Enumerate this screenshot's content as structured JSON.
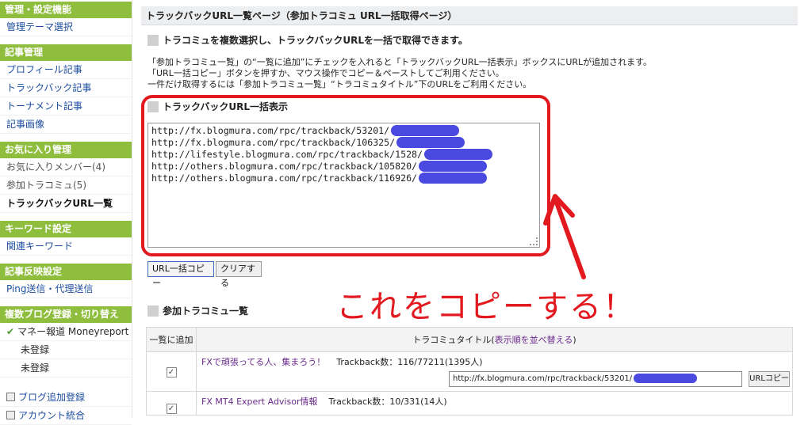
{
  "sidebar": {
    "admin": {
      "heading": "管理・設定機能",
      "items": [
        "管理テーマ選択"
      ]
    },
    "articles": {
      "heading": "記事管理",
      "items": [
        "プロフィール記事",
        "トラックバック記事",
        "トーナメント記事",
        "記事画像"
      ]
    },
    "favorites": {
      "heading": "お気に入り管理",
      "items": [
        "お気に入りメンバー(4)",
        "参加トラコミュ(5)",
        "トラックバックURL一覧"
      ]
    },
    "keywords": {
      "heading": "キーワード設定",
      "items": [
        "関連キーワード"
      ]
    },
    "reflect": {
      "heading": "記事反映設定",
      "items": [
        "Ping送信・代理送信"
      ]
    },
    "multi": {
      "heading": "複数ブログ登録・切り替え",
      "blog": "マネー報道 Moneyreport",
      "unregistered": [
        "未登録",
        "未登録"
      ]
    },
    "bottom": [
      "ブログ追加登録",
      "アカウント統合"
    ]
  },
  "main": {
    "title": "トラックバックURL一覧ページ（参加トラコミュ URL一括取得ページ）",
    "intro_heading": "トラコミュを複数選択し、トラックバックURLを一括で取得できます。",
    "desc": [
      "「参加トラコミュ一覧」の“一覧に追加”にチェックを入れると「トラックバックURL一括表示」ボックスにURLが追加されます。",
      "「URL一括コピー」ボタンを押すか、マウス操作でコピー＆ペーストしてご利用ください。",
      "一件だけ取得するには「参加トラコミュ一覧」“トラコミュタイトル”下のURLをご利用ください。"
    ],
    "bulk_heading": "トラックバックURL一括表示",
    "urls": [
      "http://fx.blogmura.com/rpc/trackback/53201/",
      "http://fx.blogmura.com/rpc/trackback/106325/",
      "http://lifestyle.blogmura.com/rpc/trackback/1528/",
      "http://others.blogmura.com/rpc/trackback/105820/",
      "http://others.blogmura.com/rpc/trackback/116926/"
    ],
    "copy_button": "URL一括コピー",
    "clear_button": "クリアする",
    "annotation": "これをコピーする！",
    "list_heading": "参加トラコミュ一覧",
    "table": {
      "col1": "一覧に追加",
      "col2_prefix": "トラコミュタイトル(",
      "col2_link": "表示順を並べ替える",
      "col2_suffix": ")",
      "rows": [
        {
          "title": "FXで頑張ってる人、集まろう！",
          "stats": "Trackback数：116/77211(1395人)",
          "url": "http://fx.blogmura.com/rpc/trackback/53201/",
          "copy": "URLコピー"
        },
        {
          "title": "FX MT4 Expert Advisor情報",
          "stats": "Trackback数：10/331(14人)"
        }
      ]
    }
  },
  "colors": {
    "accent": "#8fbe3e",
    "highlight": "#e2191f"
  }
}
